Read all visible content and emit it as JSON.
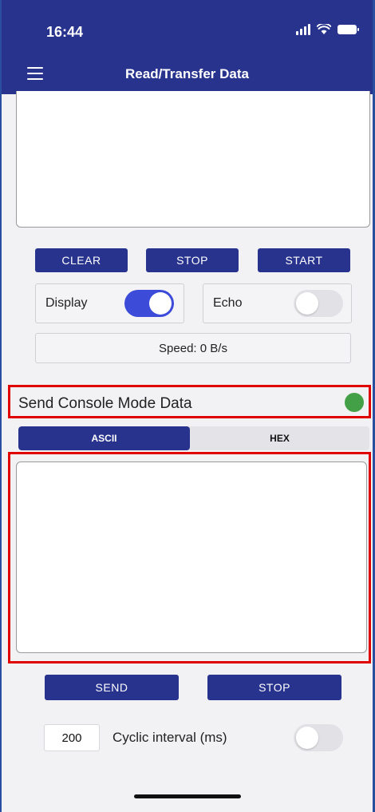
{
  "status_bar": {
    "time": "16:44"
  },
  "header": {
    "title": "Read/Transfer Data",
    "menu_icon": "hamburger-menu-icon"
  },
  "receive": {
    "buttons": {
      "clear": "CLEAR",
      "stop": "STOP",
      "start": "START"
    },
    "display_label": "Display",
    "display_on": true,
    "echo_label": "Echo",
    "echo_on": false,
    "speed": "Speed: 0 B/s"
  },
  "send": {
    "title": "Send Console Mode Data",
    "status_color": "#43a047",
    "modes": {
      "ascii": "ASCII",
      "hex": "HEX",
      "selected": "ASCII"
    },
    "input_value": "",
    "buttons": {
      "send": "SEND",
      "stop": "STOP"
    },
    "interval_value": "200",
    "interval_label": "Cyclic interval (ms)",
    "cyclic_on": false
  },
  "colors": {
    "primary": "#28338e",
    "toggle_on": "#3d4bd9",
    "highlight": "#e00000"
  }
}
